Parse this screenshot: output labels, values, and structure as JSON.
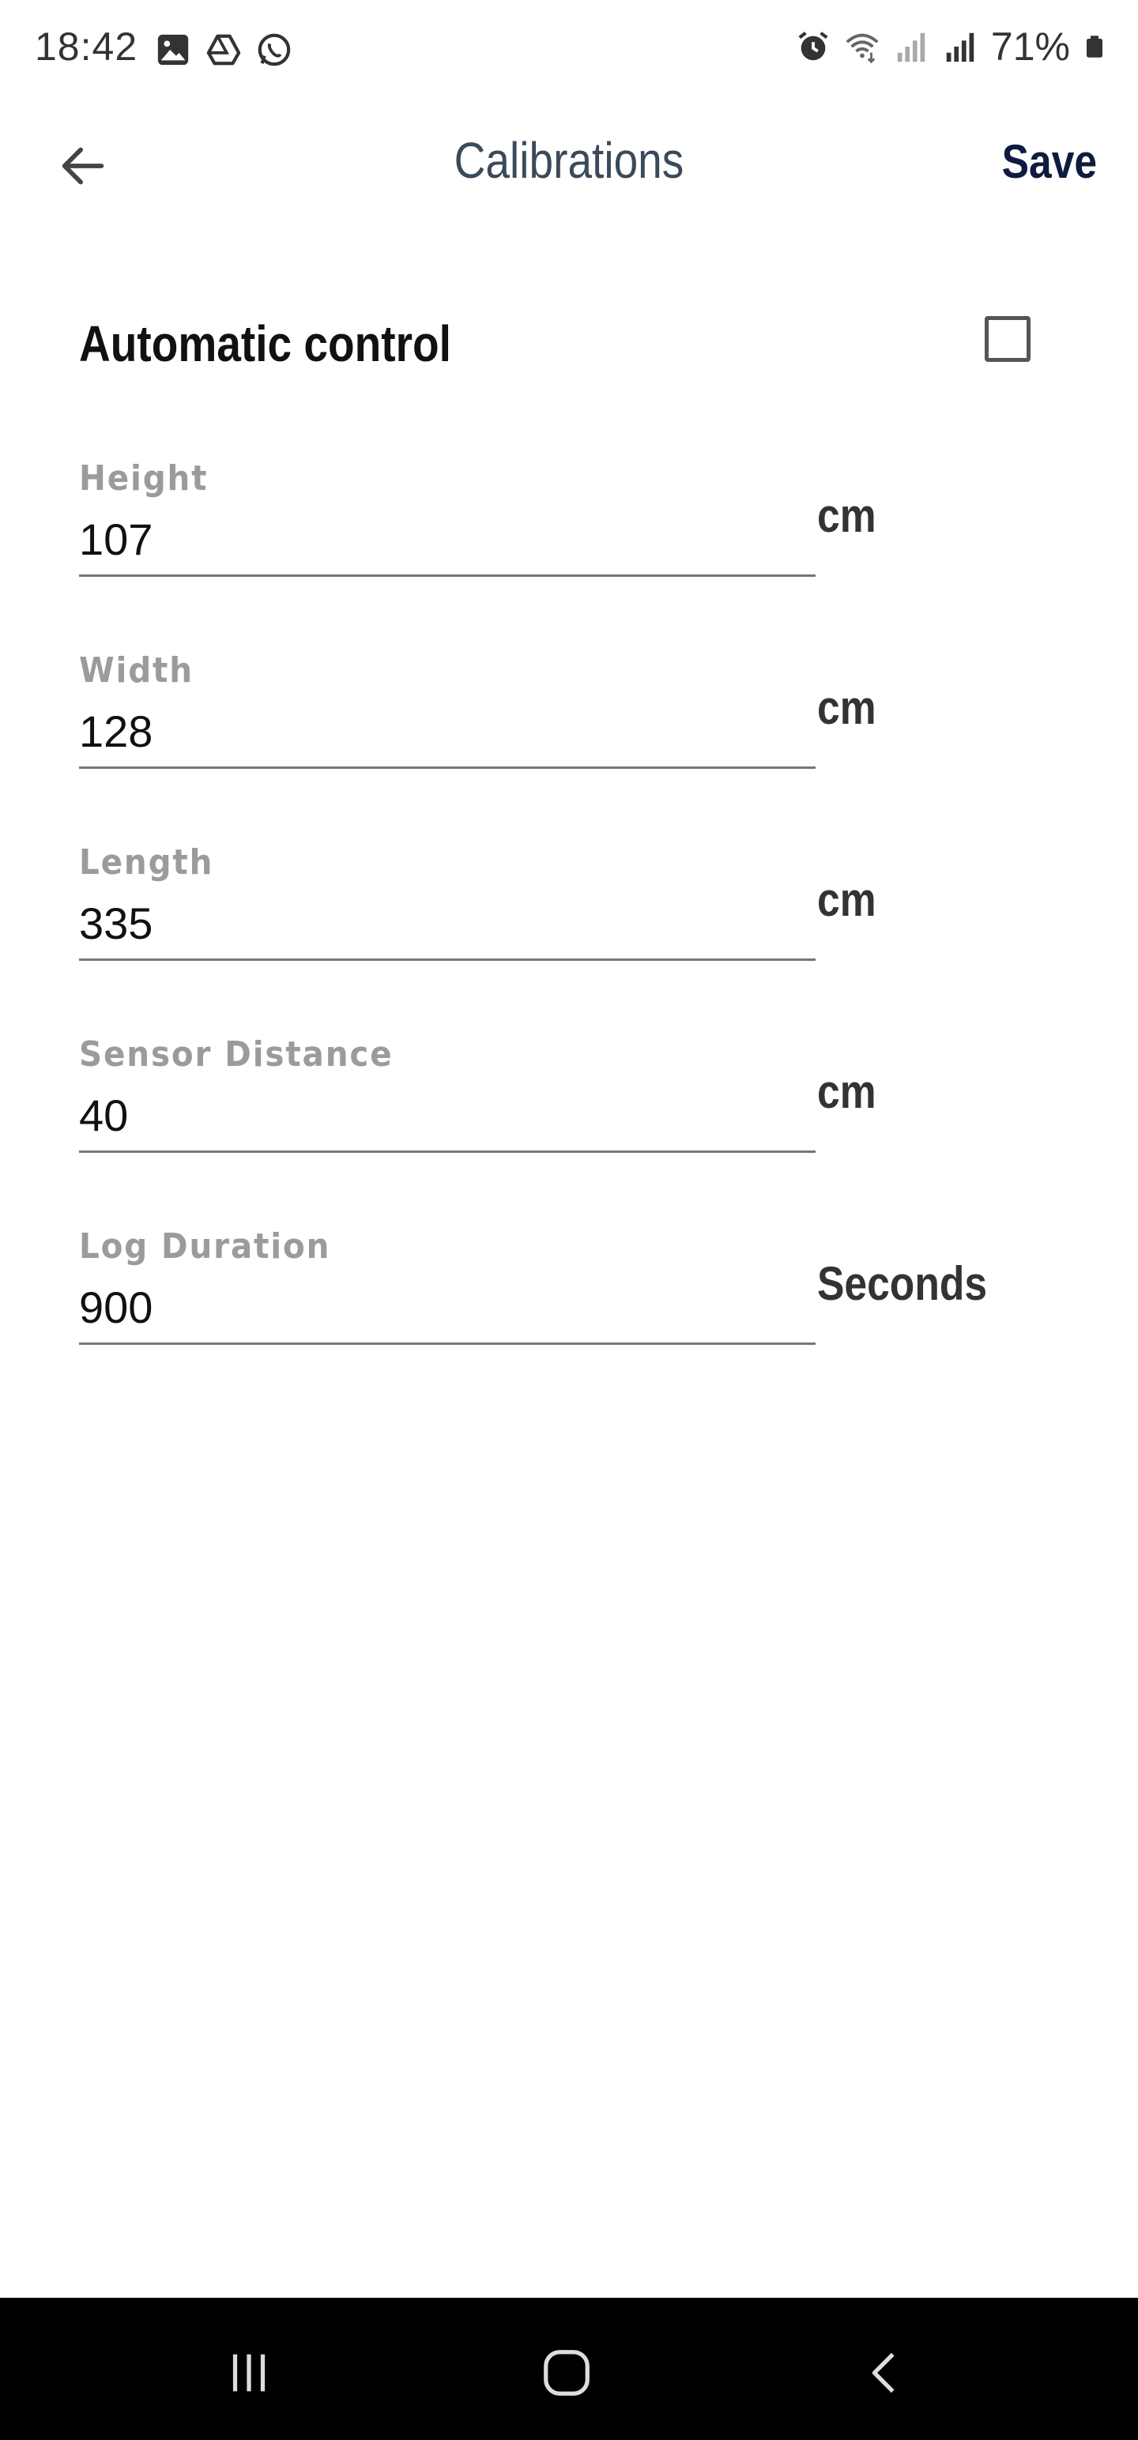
{
  "status_bar": {
    "time": "18:42",
    "battery_percent": "71%",
    "left_icons": [
      "gallery-icon",
      "drive-icon",
      "whatsapp-icon"
    ],
    "right_icons": [
      "alarm-icon",
      "wifi-icon",
      "signal-weak-icon",
      "signal-icon",
      "battery-icon"
    ]
  },
  "app_bar": {
    "title": "Calibrations",
    "save_label": "Save",
    "back_icon": "arrow-left-icon"
  },
  "automatic_control": {
    "label": "Automatic control",
    "checked": false
  },
  "fields": [
    {
      "label": "Height",
      "value": "107",
      "unit": "cm"
    },
    {
      "label": "Width",
      "value": "128",
      "unit": "cm"
    },
    {
      "label": "Length",
      "value": "335",
      "unit": "cm"
    },
    {
      "label": "Sensor Distance",
      "value": "40",
      "unit": "cm"
    },
    {
      "label": "Log Duration",
      "value": "900",
      "unit": "Seconds"
    }
  ],
  "nav_bar": {
    "icons": [
      "recent-apps-icon",
      "home-icon",
      "back-icon"
    ]
  },
  "colors": {
    "title": "#3a4a5a",
    "save": "#0f1c3f",
    "field_label": "#9b9b9b",
    "underline": "#777777",
    "nav_bar": "#000000"
  }
}
